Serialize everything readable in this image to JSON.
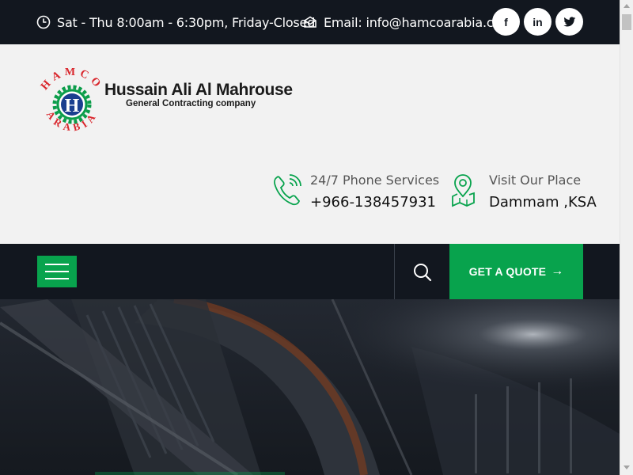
{
  "topbar": {
    "hours": "Sat - Thu 8:00am - 6:30pm, Friday-Closed",
    "email": "Email: info@hamcoarabia.com",
    "social": [
      {
        "icon": "facebook-icon",
        "glyph": "f"
      },
      {
        "icon": "linkedin-icon",
        "glyph": "in"
      },
      {
        "icon": "twitter-icon"
      }
    ]
  },
  "header": {
    "logo": {
      "ring_text": "HAMCO ARABIA",
      "letter": "H",
      "company_name": "Hussain Ali Al Mahrouse",
      "company_sub": "General Contracting company"
    },
    "contacts": [
      {
        "icon": "phone-icon",
        "label": "24/7 Phone Services",
        "value": "+966-138457931"
      },
      {
        "icon": "map-pin-icon",
        "label": "Visit Our Place",
        "value": "Dammam ,KSA"
      }
    ]
  },
  "nav": {
    "menu_icon": "hamburger-icon",
    "search_icon": "search-icon",
    "quote_label": "GET A QUOTE",
    "quote_arrow": "→"
  },
  "colors": {
    "dark": "#12171f",
    "accent_green": "#08a34d",
    "logo_red": "#d9262c",
    "logo_blue": "#1b3f8f"
  }
}
